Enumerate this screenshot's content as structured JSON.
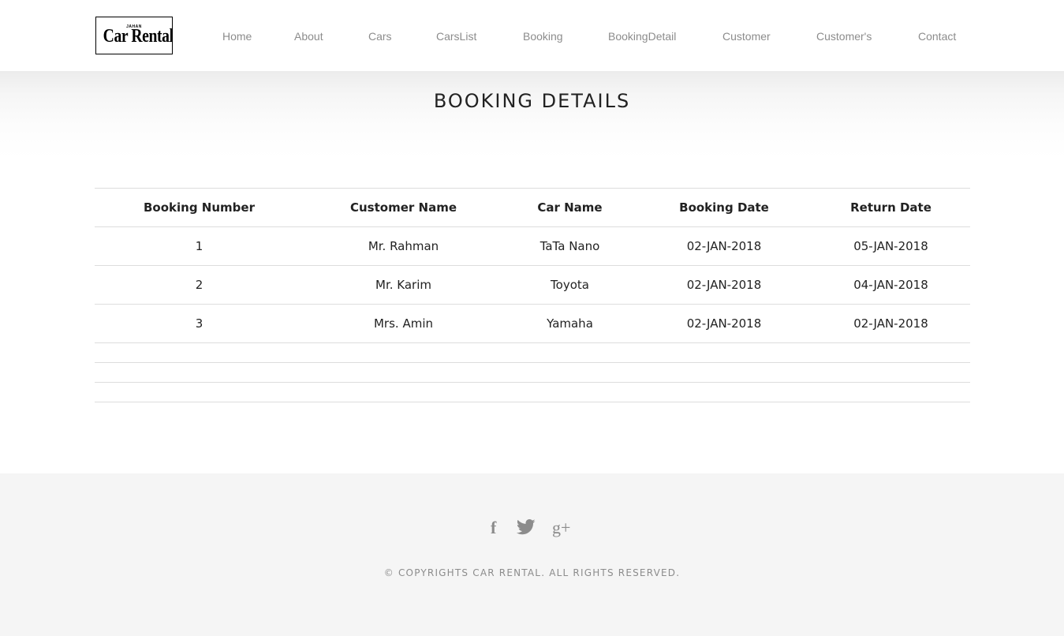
{
  "logo": {
    "small_text": "JAHAN",
    "main_text": "Car Rental"
  },
  "nav": {
    "items": [
      {
        "label": "Home"
      },
      {
        "label": "About"
      },
      {
        "label": "Cars"
      },
      {
        "label": "CarsList"
      },
      {
        "label": "Booking"
      },
      {
        "label": "BookingDetail"
      },
      {
        "label": "Customer"
      },
      {
        "label": "Customer's"
      },
      {
        "label": "Contact"
      }
    ]
  },
  "page": {
    "title": "BOOKING DETAILS"
  },
  "table": {
    "headers": [
      "Booking Number",
      "Customer Name",
      "Car Name",
      "Booking Date",
      "Return Date"
    ],
    "rows": [
      [
        "1",
        "Mr. Rahman",
        "TaTa Nano",
        "02-JAN-2018",
        "05-JAN-2018"
      ],
      [
        "2",
        "Mr. Karim",
        "Toyota",
        "02-JAN-2018",
        "04-JAN-2018"
      ],
      [
        "3",
        "Mrs. Amin",
        "Yamaha",
        "02-JAN-2018",
        "02-JAN-2018"
      ]
    ],
    "empty_rows": 3
  },
  "footer": {
    "social": [
      {
        "icon": "facebook-icon",
        "glyph": "f"
      },
      {
        "icon": "twitter-icon",
        "glyph": ""
      },
      {
        "icon": "google-plus-icon",
        "glyph": "g+"
      }
    ],
    "copyright": "© COPYRIGHTS CAR RENTAL. ALL RIGHTS RESERVED."
  },
  "colors": {
    "nav_text": "#8c8c8c",
    "title_text": "#222222",
    "footer_bg": "#f5f5f5",
    "table_border": "#dddddd"
  }
}
